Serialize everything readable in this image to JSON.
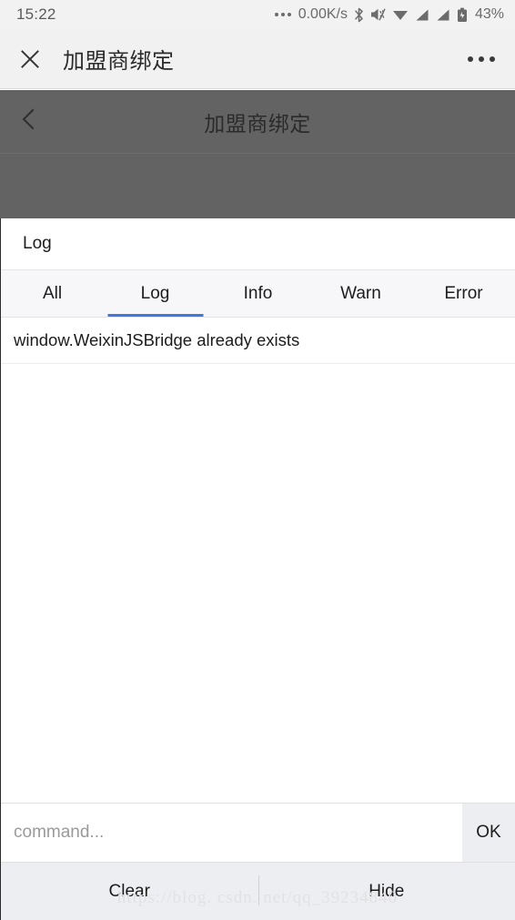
{
  "status_bar": {
    "time": "15:22",
    "network_speed": "0.00K/s",
    "battery_percent": "43%",
    "icons": [
      "more-dots-icon",
      "bluetooth-icon",
      "mute-icon",
      "wifi-icon",
      "signal-icon",
      "signal-icon",
      "battery-charging-icon"
    ]
  },
  "wechat_header": {
    "close_icon": "close-icon",
    "title": "加盟商绑定",
    "more_icon": "more-options-icon"
  },
  "page_nav": {
    "back_icon": "chevron-left-icon",
    "title": "加盟商绑定"
  },
  "console": {
    "title": "Log",
    "tabs": [
      {
        "label": "All",
        "active": false
      },
      {
        "label": "Log",
        "active": true
      },
      {
        "label": "Info",
        "active": false
      },
      {
        "label": "Warn",
        "active": false
      },
      {
        "label": "Error",
        "active": false
      }
    ],
    "active_tab_color": "#4277e0",
    "logs": [
      {
        "text": "window.WeixinJSBridge already exists"
      }
    ],
    "command": {
      "value": "",
      "placeholder": "command...",
      "ok_label": "OK"
    },
    "footer": {
      "clear_label": "Clear",
      "hide_label": "Hide"
    }
  },
  "watermark": {
    "text": "https://blog. csdn. net/qq_39234840"
  }
}
